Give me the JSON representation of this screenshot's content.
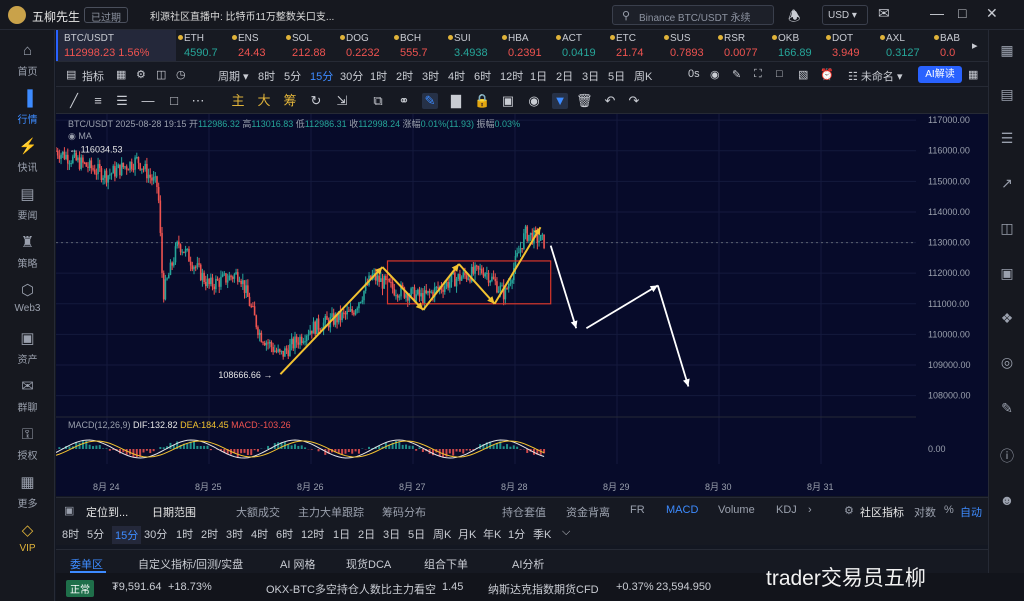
{
  "app": {
    "name": "五柳先生",
    "expired_badge": "已过期",
    "live_text": "利源社区直播中: 比特币11万整数关口支...",
    "search_placeholder": "Binance BTC/USDT 永续",
    "currency": "USD"
  },
  "left_nav": [
    {
      "label": "首页",
      "icon": "home-icon"
    },
    {
      "label": "行情",
      "icon": "bar-chart-icon",
      "active": true
    },
    {
      "label": "快讯",
      "icon": "flash-news-icon"
    },
    {
      "label": "要闻",
      "icon": "newspaper-icon"
    },
    {
      "label": "策略",
      "icon": "chess-icon"
    },
    {
      "label": "Web3",
      "icon": "web3-icon"
    },
    {
      "label": "资产",
      "icon": "wallet-icon"
    },
    {
      "label": "群聊",
      "icon": "chat-icon"
    },
    {
      "label": "授权",
      "icon": "key-icon"
    },
    {
      "label": "更多",
      "icon": "grid-icon"
    },
    {
      "label": "VIP",
      "icon": "diamond-icon",
      "vip": true
    }
  ],
  "tickers": [
    {
      "name": "BTC/USDT",
      "price": "112998.23",
      "change": "1.56%",
      "dir": "up"
    },
    {
      "name": "ETH",
      "price": "4590.7",
      "dir": "up"
    },
    {
      "name": "ENS",
      "price": "24.43",
      "dir": "dn"
    },
    {
      "name": "SOL",
      "price": "212.88",
      "dir": "dn"
    },
    {
      "name": "DOG",
      "price": "0.2232",
      "dir": "dn"
    },
    {
      "name": "BCH",
      "price": "555.7",
      "dir": "dn"
    },
    {
      "name": "SUI",
      "price": "3.4938",
      "dir": "up"
    },
    {
      "name": "HBA",
      "price": "0.2391",
      "dir": "dn"
    },
    {
      "name": "ACT",
      "price": "0.0419",
      "dir": "up"
    },
    {
      "name": "ETC",
      "price": "21.74",
      "dir": "dn"
    },
    {
      "name": "SUS",
      "price": "0.7893",
      "dir": "dn"
    },
    {
      "name": "RSR",
      "price": "0.0077",
      "dir": "dn"
    },
    {
      "name": "OKB",
      "price": "166.89",
      "dir": "up"
    },
    {
      "name": "DOT",
      "price": "3.949",
      "dir": "dn"
    },
    {
      "name": "AXL",
      "price": "0.3127",
      "dir": "up"
    },
    {
      "name": "BAB",
      "price": "0.0",
      "dir": "dn"
    }
  ],
  "toolbar1": {
    "indicators": "指标",
    "period": "周期",
    "intervals": [
      "8时",
      "5分",
      "15分",
      "30分",
      "1时",
      "2时",
      "3时",
      "4时",
      "6时",
      "12时",
      "1日",
      "2日",
      "3日",
      "5日",
      "周K"
    ],
    "active_interval": "15分",
    "countdown": "0s",
    "layout_name": "未命名",
    "ai_button": "AI解读"
  },
  "toolbar2": {
    "main_label": "主",
    "big_label": "大",
    "chou_label": "筹"
  },
  "chart_legend": {
    "symbol": "BTC/USDT",
    "datetime": "2025-08-28 19:15",
    "open_label": "开",
    "open": "112986.32",
    "high_label": "高",
    "high": "113016.83",
    "low_label": "低",
    "low": "112986.31",
    "close_label": "收",
    "close": "112998.24",
    "change_label": "涨幅",
    "change": "0.01%(11.93)",
    "amp_label": "振幅",
    "amp": "0.03%",
    "ma_label": "MA",
    "macd_label": "MACD(12,26,9)",
    "dif": "DIF:132.82",
    "dea": "DEA:184.45",
    "macd": "MACD:-103.26"
  },
  "chart_data": {
    "type": "candlestick",
    "symbol": "BTC/USDT",
    "interval": "15m",
    "x_labels": [
      "8月 24",
      "8月 25",
      "8月 26",
      "8月 27",
      "8月 28",
      "8月 29",
      "8月 30",
      "8月 31"
    ],
    "y_ticks": [
      117000,
      116000,
      115000,
      114000,
      113000,
      112000,
      111000,
      110000,
      109000,
      108000
    ],
    "ylim": [
      107400,
      117200
    ],
    "high_marker": 116034.53,
    "low_marker": 108666.66,
    "current_price": 112998.24,
    "approx_close_path": [
      {
        "x": 0.0,
        "y": 116000
      },
      {
        "x": 0.3,
        "y": 115500
      },
      {
        "x": 0.5,
        "y": 115200
      },
      {
        "x": 0.8,
        "y": 115700
      },
      {
        "x": 1.0,
        "y": 114800
      },
      {
        "x": 1.05,
        "y": 111300
      },
      {
        "x": 1.2,
        "y": 113000
      },
      {
        "x": 1.5,
        "y": 111600
      },
      {
        "x": 1.8,
        "y": 112000
      },
      {
        "x": 2.0,
        "y": 110000
      },
      {
        "x": 2.2,
        "y": 109300
      },
      {
        "x": 2.5,
        "y": 110200
      },
      {
        "x": 2.9,
        "y": 110700
      },
      {
        "x": 3.1,
        "y": 111900
      },
      {
        "x": 3.3,
        "y": 111500
      },
      {
        "x": 3.6,
        "y": 111200
      },
      {
        "x": 3.9,
        "y": 111800
      },
      {
        "x": 4.2,
        "y": 112100
      },
      {
        "x": 4.4,
        "y": 111300
      },
      {
        "x": 4.6,
        "y": 113300
      },
      {
        "x": 4.8,
        "y": 112998
      }
    ],
    "support_box": {
      "from_x": 3.25,
      "to_x": 4.85,
      "low": 111000,
      "high": 112400
    },
    "projection_path": [
      {
        "x": 4.85,
        "y": 112900
      },
      {
        "x": 5.1,
        "y": 110200
      },
      {
        "x": 5.2,
        "y": 110200
      },
      {
        "x": 5.9,
        "y": 111600
      },
      {
        "x": 6.2,
        "y": 108300
      }
    ],
    "macd_zero_label": "0.00",
    "colors": {
      "up": "#26a69a",
      "down": "#ef5350",
      "arrow_yellow": "#f2c230",
      "box": "#d9372b",
      "projection": "#ffffff"
    }
  },
  "bottom_toolbar": {
    "locate": "定位到...",
    "date_range": "日期范围",
    "items": [
      "大额成交",
      "主力大单跟踪",
      "筹码分布",
      "持仓套值",
      "资金背离",
      "FR",
      "MACD",
      "Volume",
      "KDJ"
    ],
    "active_item": "MACD",
    "community": "社区指标",
    "log": "对数",
    "percent": "%",
    "auto": "自动"
  },
  "bottom_intervals": {
    "items": [
      "8时",
      "5分",
      "15分",
      "30分",
      "1时",
      "2时",
      "3时",
      "4时",
      "6时",
      "12时",
      "1日",
      "2日",
      "3日",
      "5日",
      "周K",
      "月K",
      "年K",
      "1分",
      "季K"
    ],
    "active": "15分"
  },
  "tabs": {
    "items": [
      "委单区",
      "自定义指标/回测/实盘",
      "AI 网格",
      "现货DCA",
      "组合下单",
      "AI分析"
    ],
    "active": "委单区"
  },
  "status_bar": {
    "live": "正常",
    "balance": "₮9,591.64",
    "balance_change": "+18.73%",
    "okx_label": "OKX-BTC多空持仓人数比",
    "okx_signal": "主力看空",
    "okx_value": "1.45",
    "nasdaq_label": "纳斯达克指数期货CFD",
    "nasdaq_change": "+0.37%",
    "nasdaq_value": "23,594.950"
  },
  "watermark": "trader交易员五柳"
}
